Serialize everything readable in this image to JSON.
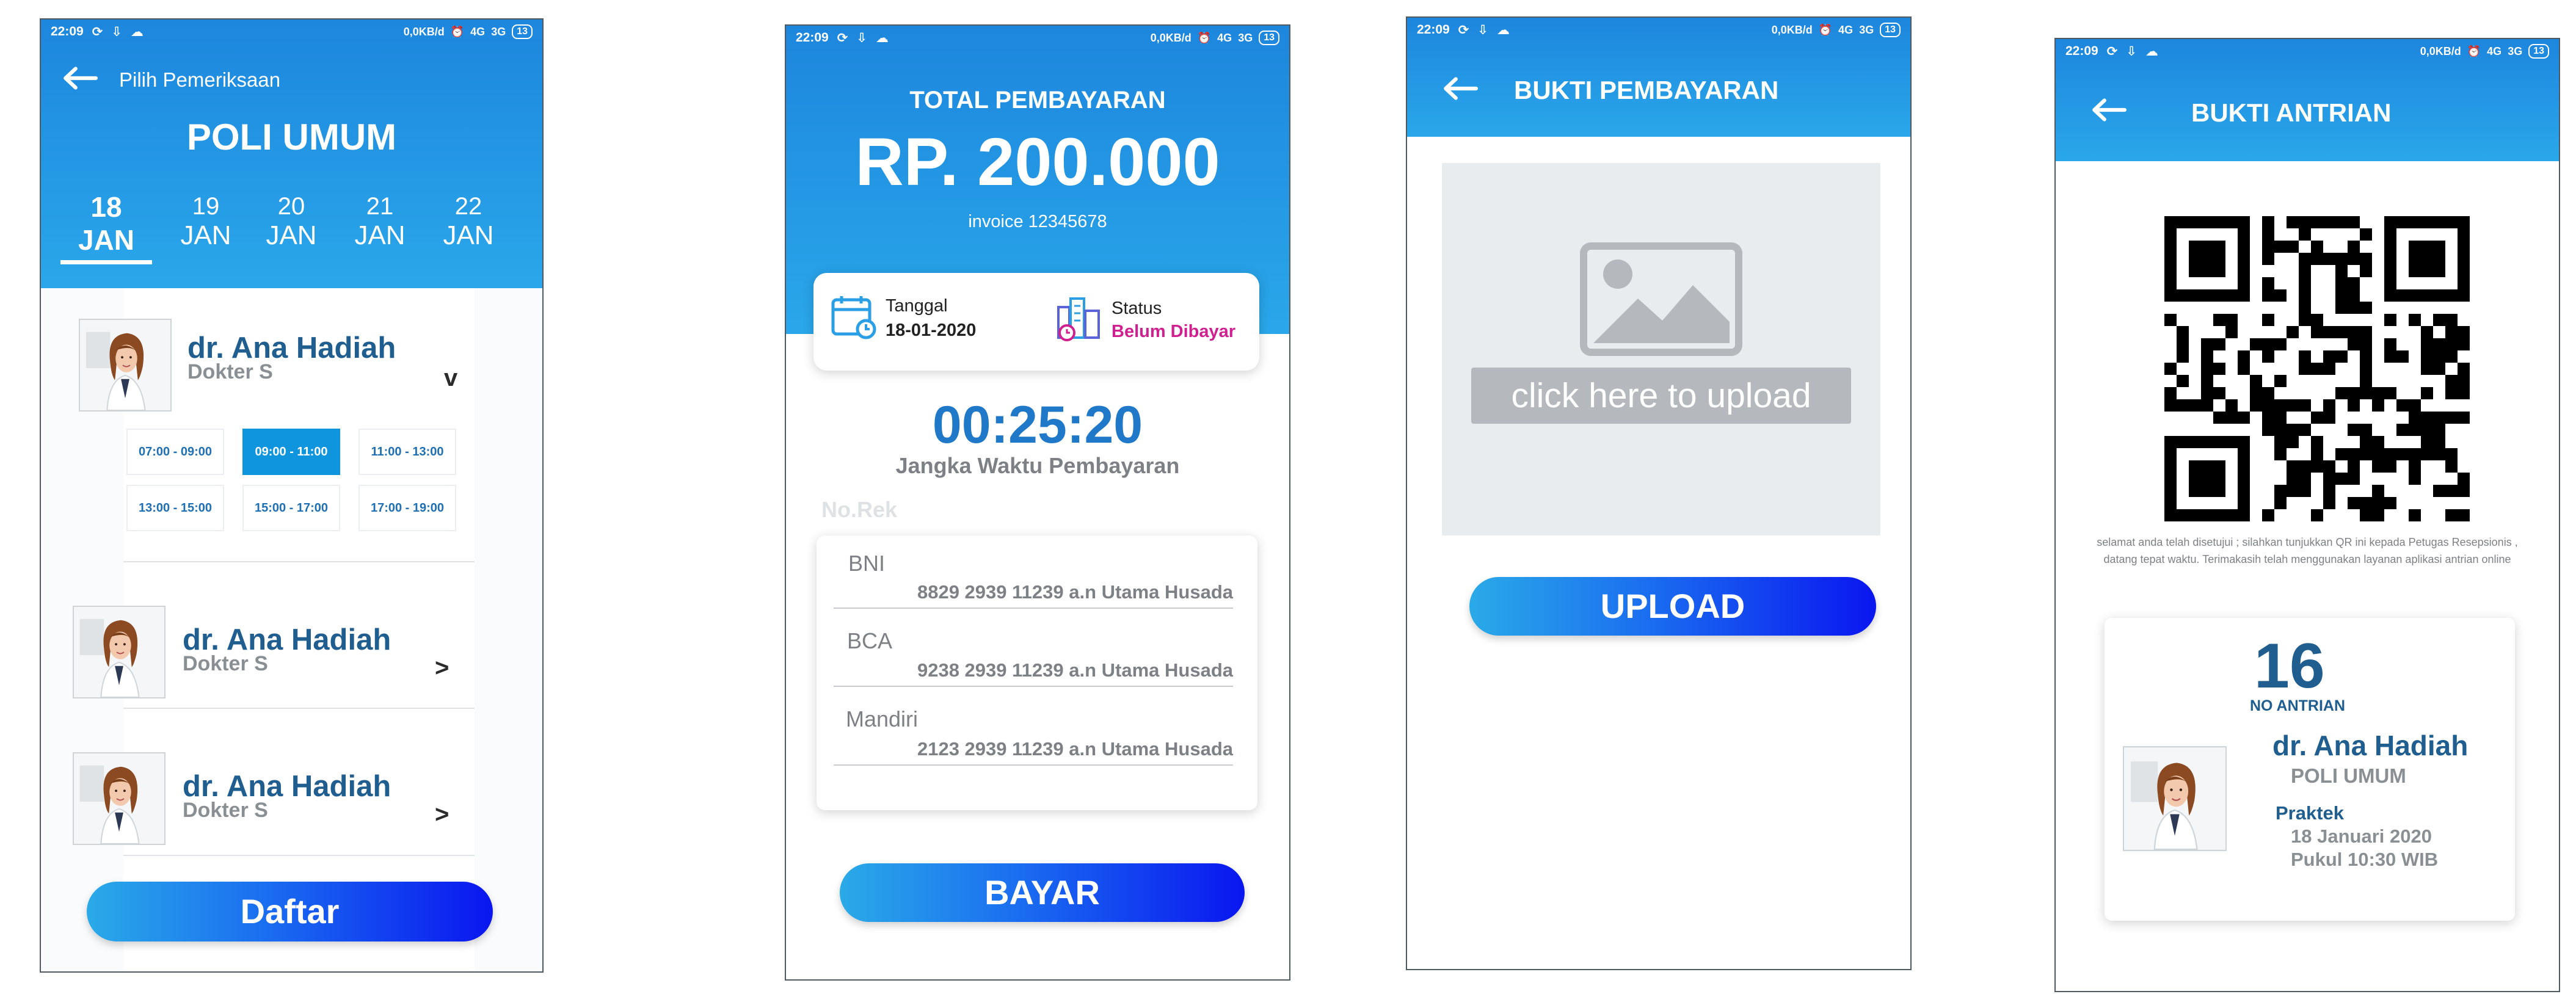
{
  "status": {
    "time": "22:09",
    "speed": "0,0KB/d",
    "net1": "4G",
    "net2": "3G",
    "battery": "13"
  },
  "screen1": {
    "back_label": "Pilih Pemeriksaan",
    "title": "POLI UMUM",
    "dates": [
      {
        "day": "18",
        "month": "JAN"
      },
      {
        "day": "19",
        "month": "JAN"
      },
      {
        "day": "20",
        "month": "JAN"
      },
      {
        "day": "21",
        "month": "JAN"
      },
      {
        "day": "22",
        "month": "JAN"
      }
    ],
    "doctors": [
      {
        "name": "dr. Ana Hadiah",
        "sub": "Dokter S",
        "toggle": "v"
      },
      {
        "name": "dr. Ana Hadiah",
        "sub": "Dokter S",
        "toggle": ">"
      },
      {
        "name": "dr. Ana Hadiah",
        "sub": "Dokter S",
        "toggle": ">"
      }
    ],
    "slots": [
      "07:00 - 09:00",
      "09:00 - 11:00",
      "11:00 - 13:00",
      "13:00 - 15:00",
      "15:00 - 17:00",
      "17:00 - 19:00"
    ],
    "button": "Daftar"
  },
  "screen2": {
    "title": "TOTAL PEMBAYARAN",
    "amount": "RP. 200.000",
    "invoice": "invoice 12345678",
    "date_label": "Tanggal",
    "date_value": "18-01-2020",
    "status_label": "Status",
    "status_value": "Belum Dibayar",
    "timer": "00:25:20",
    "timer_label": "Jangka Waktu Pembayaran",
    "norek_label": "No.Rek",
    "banks": [
      {
        "bank": "BNI",
        "account": "8829 2939 11239 a.n Utama Husada"
      },
      {
        "bank": "BCA",
        "account": "9238 2939 11239 a.n Utama Husada"
      },
      {
        "bank": "Mandiri",
        "account": "2123 2939 11239 a.n Utama Husada"
      }
    ],
    "button": "BAYAR"
  },
  "screen3": {
    "title": "BUKTI PEMBAYARAN",
    "upload_hint": "click here to upload",
    "button": "UPLOAD"
  },
  "screen4": {
    "title": "BUKTI ANTRIAN",
    "message_line1": "selamat anda telah disetujui ; silahkan tunjukkan QR ini kepada Petugas Resepsionis ,",
    "message_line2": "datang tepat waktu. Terimakasih telah menggunakan layanan aplikasi antrian online",
    "queue_number": "16",
    "queue_label": "NO ANTRIAN",
    "doctor_name": "dr. Ana Hadiah",
    "poli": "POLI UMUM",
    "praktek_label": "Praktek",
    "praktek_date": "18 Januari 2020",
    "praktek_time": "Pukul 10:30 WIB"
  }
}
